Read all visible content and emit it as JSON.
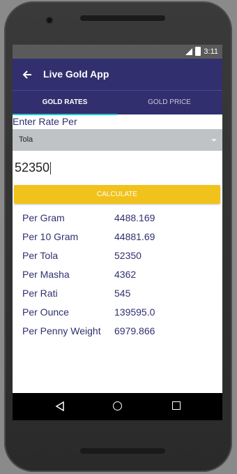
{
  "status": {
    "time": "3:11"
  },
  "app": {
    "title": "Live Gold App"
  },
  "tabs": [
    {
      "label": "GOLD RATES",
      "active": true
    },
    {
      "label": "GOLD PRICE",
      "active": false
    }
  ],
  "form": {
    "rate_label": "Enter Rate Per",
    "unit_selected": "Tola",
    "rate_value": "52350",
    "calculate_label": "CALCULATE"
  },
  "results": [
    {
      "label": "Per Gram",
      "value": "4488.169"
    },
    {
      "label": "Per 10 Gram",
      "value": "44881.69"
    },
    {
      "label": "Per Tola",
      "value": "52350"
    },
    {
      "label": "Per Masha",
      "value": "4362"
    },
    {
      "label": "Per Rati",
      "value": "545"
    },
    {
      "label": "Per Ounce",
      "value": "139595.0"
    },
    {
      "label": "Per Penny Weight",
      "value": "6979.866"
    }
  ],
  "colors": {
    "appbar": "#322f6e",
    "tab_indicator": "#1ecad3",
    "button": "#f1c21b",
    "text": "#303070"
  },
  "icons": [
    "back-arrow-icon",
    "signal-icon",
    "battery-icon",
    "nav-back-icon",
    "nav-home-icon",
    "nav-recents-icon",
    "dropdown-arrow-icon"
  ]
}
